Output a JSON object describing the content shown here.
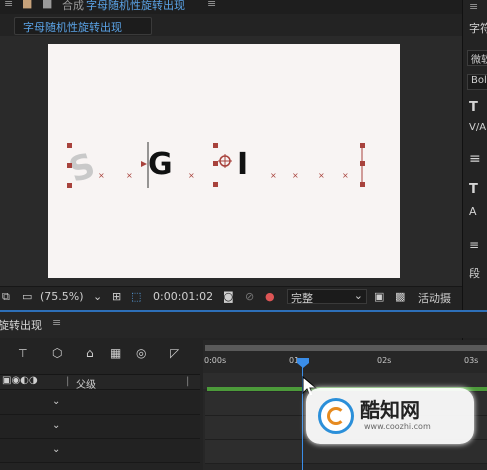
{
  "comp_bar": {
    "title_prefix": "合成",
    "comp_name": "字母随机性旋转出现"
  },
  "comp_tab": {
    "label": "字母随机性旋转出现"
  },
  "canvas_letters": {
    "s": "S",
    "g": "G",
    "i": "I"
  },
  "viewer_toolbar": {
    "zoom": "(75.5%)",
    "timecode": "0:00:01:02",
    "resolution": "完整",
    "active_camera": "活动摄"
  },
  "right_panel": {
    "char_label": "字符",
    "font_field": "微软",
    "style_field": "Bold",
    "para_label": "段"
  },
  "timeline": {
    "tab_label": "旋转出现",
    "col_parent": "父级",
    "ruler_ticks": [
      "0:00s",
      "01",
      "02s",
      "03s"
    ]
  },
  "watermark": {
    "brand": "酷知网",
    "url": "www.coozhi.com"
  },
  "colors": {
    "accent": "#2d6fb8",
    "playhead": "#3a8de8",
    "canvas": "#f8f4f3",
    "handle": "#a8423c",
    "track_bar": "#4c9a3a"
  }
}
